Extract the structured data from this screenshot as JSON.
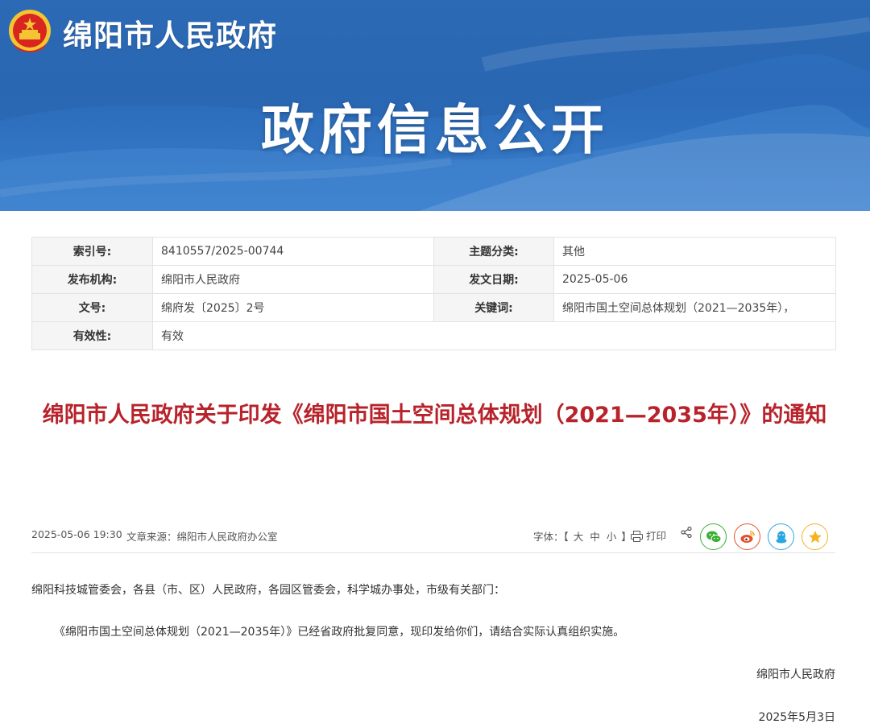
{
  "header": {
    "site_name": "绵阳市人民政府",
    "banner_title": "政府信息公开",
    "emblem_icon": "national-emblem-icon"
  },
  "meta": {
    "index_label": "索引号:",
    "index_value": "8410557/2025-00744",
    "topic_label": "主题分类:",
    "topic_value": "其他",
    "publisher_label": "发布机构:",
    "publisher_value": "绵阳市人民政府",
    "issue_date_label": "发文日期:",
    "issue_date_value": "2025-05-06",
    "docno_label": "文号:",
    "docno_value": "绵府发〔2025〕2号",
    "keywords_label": "关键词:",
    "keywords_value": "绵阳市国土空间总体规划（2021—2035年），",
    "validity_label": "有效性:",
    "validity_value": "有效"
  },
  "article": {
    "title": "绵阳市人民政府关于印发《绵阳市国土空间总体规划（2021—2035年）》的通知",
    "datetime": "2025-05-06 19:30",
    "source": "文章来源：绵阳市人民政府办公室",
    "font_label": "字体：【",
    "font_large": "大",
    "font_medium": "中",
    "font_small": "小",
    "font_close": "】",
    "print_label": "打印",
    "salutation": "绵阳科技城管委会，各县（市、区）人民政府，各园区管委会，科学城办事处，市级有关部门：",
    "paragraph": "《绵阳市国土空间总体规划（2021—2035年）》已经省政府批复同意，现印发给你们，请结合实际认真组织实施。",
    "signature": "绵阳市人民政府",
    "sign_date": "2025年5月3日"
  },
  "share": {
    "wechat_color": "#3cb034",
    "weibo_color": "#e6512b",
    "qq_color": "#2aa7e2",
    "favorite_color": "#f5b324"
  }
}
